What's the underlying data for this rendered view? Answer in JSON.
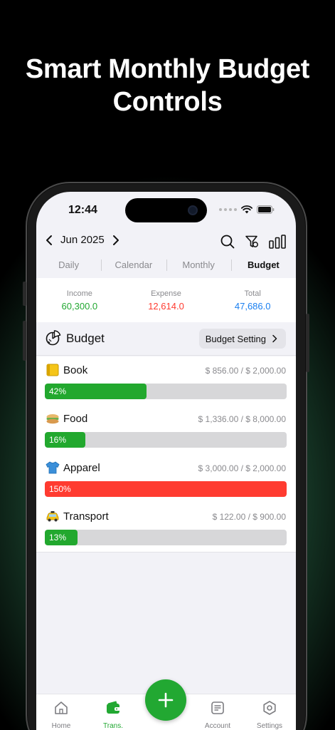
{
  "hero": {
    "line1": "Smart Monthly Budget",
    "line2": "Controls"
  },
  "status": {
    "time": "12:44"
  },
  "nav": {
    "month": "Jun 2025"
  },
  "tabs": [
    "Daily",
    "Calendar",
    "Monthly",
    "Budget"
  ],
  "active_tab": "Budget",
  "summary": {
    "income_label": "Income",
    "income_value": "60,300.0",
    "expense_label": "Expense",
    "expense_value": "12,614.0",
    "total_label": "Total",
    "total_value": "47,686.0"
  },
  "budget": {
    "title": "Budget",
    "setting_label": "Budget Setting",
    "items": [
      {
        "name": "Book",
        "amount": "$ 856.00 / $ 2,000.00",
        "percent_label": "42%",
        "progress": 0.42,
        "color": "#22a82e"
      },
      {
        "name": "Food",
        "amount": "$ 1,336.00 / $ 8,000.00",
        "percent_label": "16%",
        "progress": 0.167,
        "color": "#22a82e"
      },
      {
        "name": "Apparel",
        "amount": "$ 3,000.00 / $ 2,000.00",
        "percent_label": "150%",
        "progress": 1.0,
        "color": "#ff3b30"
      },
      {
        "name": "Transport",
        "amount": "$ 122.00 / $ 900.00",
        "percent_label": "13%",
        "progress": 0.135,
        "color": "#22a82e"
      }
    ]
  },
  "tabbar": {
    "home": "Home",
    "trans": "Trans.",
    "account": "Account",
    "settings": "Settings"
  },
  "colors": {
    "accent": "#22a832",
    "income": "#22a832",
    "expense": "#ff3b30",
    "total": "#1a7ff0"
  }
}
